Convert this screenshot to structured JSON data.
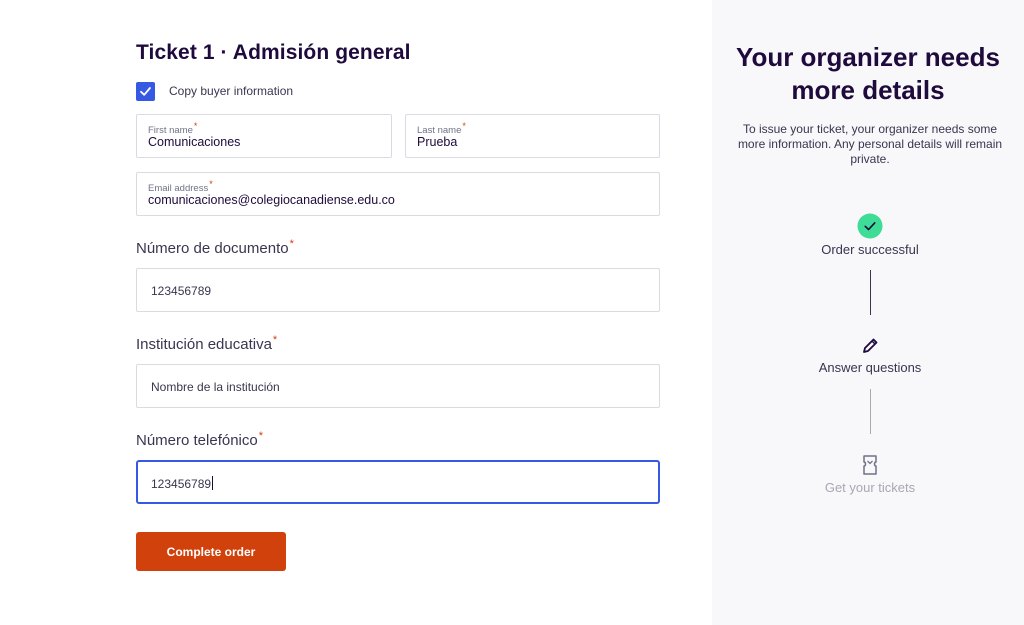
{
  "ticket": {
    "title": "Ticket 1 · Admisión general",
    "copy_buyer_label": "Copy buyer information",
    "copy_buyer_checked": true
  },
  "fields": {
    "first_name": {
      "label": "First name",
      "value": "Comunicaciones"
    },
    "last_name": {
      "label": "Last name",
      "value": "Prueba"
    },
    "email": {
      "label": "Email address",
      "value": "comunicaciones@colegiocanadiense.edu.co"
    }
  },
  "questions": [
    {
      "label": "Número de documento",
      "value": "123456789"
    },
    {
      "label": "Institución educativa",
      "value": "Nombre de la institución"
    },
    {
      "label": "Número telefónico",
      "value": "123456789"
    }
  ],
  "required_mark": "*",
  "complete_button": "Complete order",
  "side": {
    "title": "Your organizer needs more details",
    "description": "To issue your ticket, your organizer needs some more information. Any personal details will remain private.",
    "steps": [
      {
        "label": "Order successful",
        "icon": "check-circle-icon",
        "state": "done"
      },
      {
        "label": "Answer questions",
        "icon": "pencil-icon",
        "state": "current"
      },
      {
        "label": "Get your tickets",
        "icon": "ticket-icon",
        "state": "pending"
      }
    ]
  },
  "colors": {
    "accent": "#3659e3",
    "brand_orange": "#d1410c",
    "success_green": "#3ddc97",
    "sidebar_bg": "#f8f7fa"
  }
}
